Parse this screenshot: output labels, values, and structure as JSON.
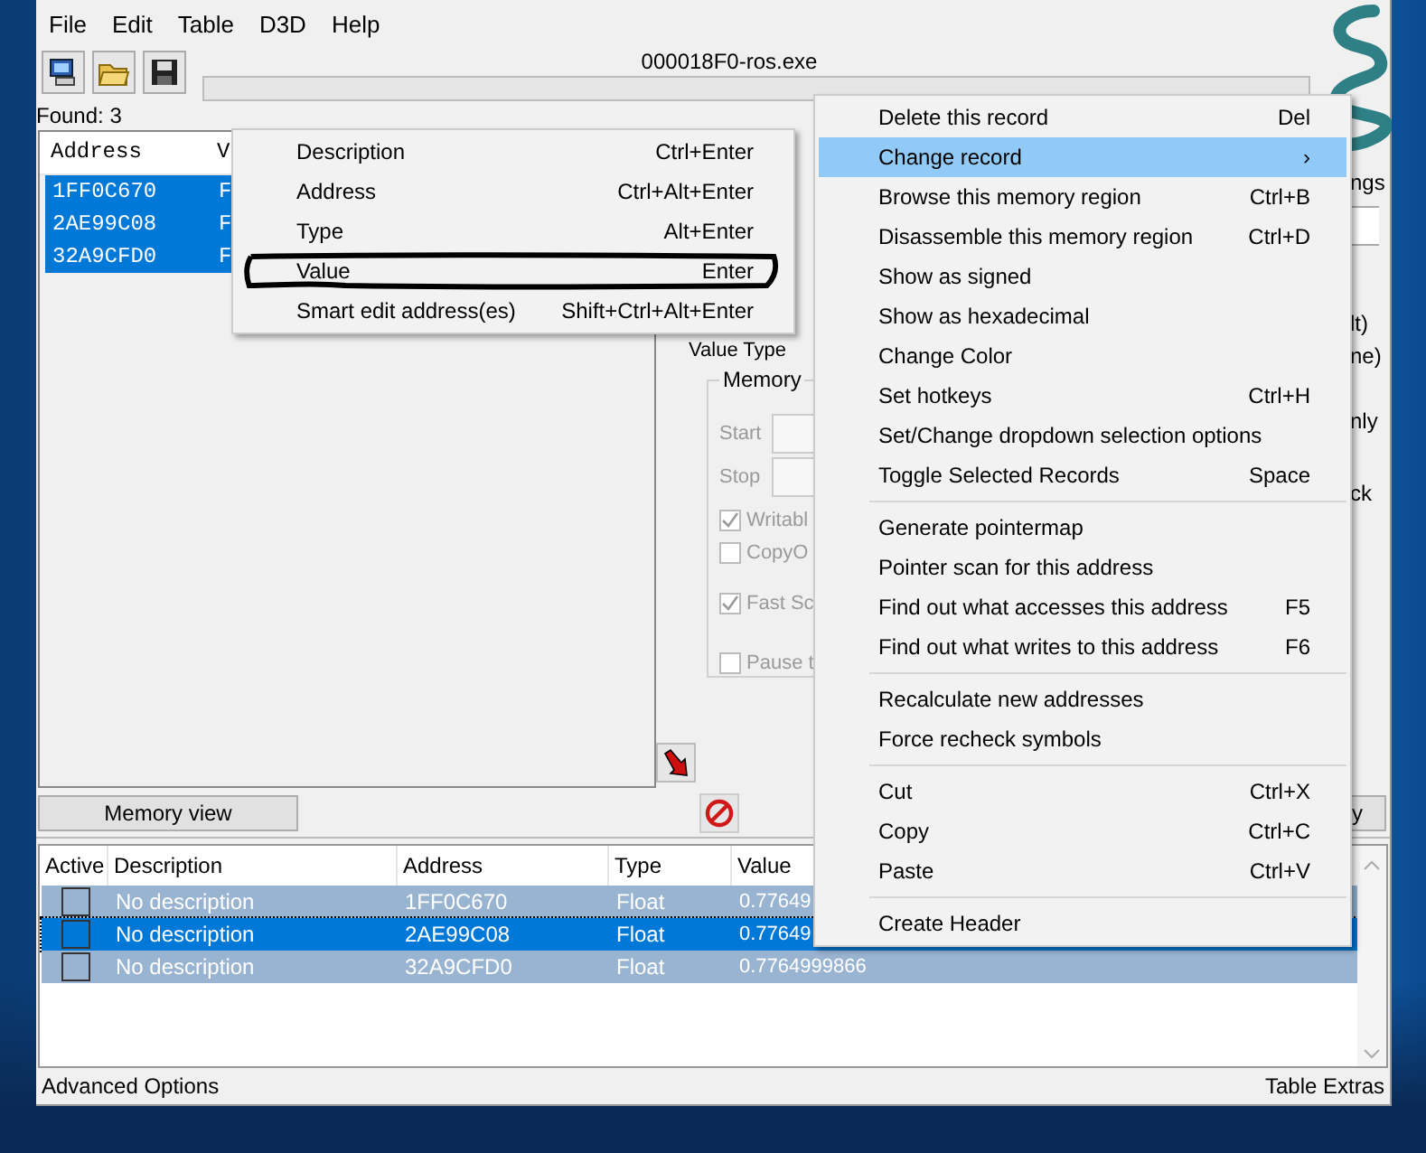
{
  "menu_bar": [
    "File",
    "Edit",
    "Table",
    "D3D",
    "Help"
  ],
  "process_title": "000018F0-ros.exe",
  "progress": {
    "level": 0
  },
  "found_label": "Found: 3",
  "found_list": {
    "columns": [
      "Address",
      "V"
    ],
    "rows": [
      {
        "address": "1FF0C670",
        "value": "F",
        "selected": true
      },
      {
        "address": "2AE99C08",
        "value": "F",
        "selected": true
      },
      {
        "address": "32A9CFD0",
        "value": "F",
        "selected": true
      }
    ]
  },
  "scan_panel": {
    "value_type_label": "Value Type",
    "memory_scan": {
      "title": "Memory",
      "disabled": true,
      "start_label": "Start",
      "stop_label": "Stop",
      "options": [
        {
          "label": "Writabl",
          "checked": true
        },
        {
          "label": "CopyO",
          "checked": false
        },
        {
          "label": "Fast Sc",
          "checked": true
        },
        {
          "label": "Pause t",
          "checked": false
        }
      ]
    },
    "right_edge_texts": [
      "ngs",
      "lt)",
      "ne)",
      "nly",
      "ck"
    ],
    "right_button": "y"
  },
  "memory_view_button": "Memory view",
  "address_table": {
    "columns": [
      "Active",
      "Description",
      "Address",
      "Type",
      "Value"
    ],
    "rows": [
      {
        "active": false,
        "description": "No description",
        "address": "1FF0C670",
        "type": "Float",
        "value": "0.77649",
        "selected": true,
        "focused": false
      },
      {
        "active": false,
        "description": "No description",
        "address": "2AE99C08",
        "type": "Float",
        "value": "0.77649",
        "selected": true,
        "focused": true
      },
      {
        "active": false,
        "description": "No description",
        "address": "32A9CFD0",
        "type": "Float",
        "value": "0.7764999866",
        "selected": true,
        "focused": false
      }
    ]
  },
  "status_bar": {
    "left": "Advanced Options",
    "right": "Table Extras"
  },
  "submenu": {
    "items": [
      {
        "kind": "item",
        "label": "Description",
        "shortcut": "Ctrl+Enter"
      },
      {
        "kind": "item",
        "label": "Address",
        "shortcut": "Ctrl+Alt+Enter"
      },
      {
        "kind": "item",
        "label": "Type",
        "shortcut": "Alt+Enter"
      },
      {
        "kind": "item",
        "label": "Value",
        "shortcut": "Enter",
        "circled": true
      },
      {
        "kind": "item",
        "label": "Smart edit address(es)",
        "shortcut": "Shift+Ctrl+Alt+Enter"
      }
    ]
  },
  "context_menu": {
    "items": [
      {
        "kind": "item",
        "label": "Delete this record",
        "shortcut": "Del",
        "selected": false
      },
      {
        "kind": "item",
        "label": "Change record",
        "arrow": "›",
        "selected": true
      },
      {
        "kind": "item",
        "label": "Browse this memory region",
        "shortcut": "Ctrl+B",
        "selected": false
      },
      {
        "kind": "item",
        "label": "Disassemble this memory region",
        "shortcut": "Ctrl+D",
        "selected": false
      },
      {
        "kind": "item",
        "label": "Show as signed",
        "selected": false
      },
      {
        "kind": "item",
        "label": "Show as hexadecimal",
        "selected": false
      },
      {
        "kind": "item",
        "label": "Change Color",
        "selected": false
      },
      {
        "kind": "item",
        "label": "Set hotkeys",
        "shortcut": "Ctrl+H",
        "selected": false
      },
      {
        "kind": "item",
        "label": "Set/Change dropdown selection options",
        "selected": false
      },
      {
        "kind": "item",
        "label": "Toggle Selected Records",
        "shortcut": "Space",
        "selected": false
      },
      {
        "kind": "separator"
      },
      {
        "kind": "item",
        "label": "Generate pointermap",
        "selected": false
      },
      {
        "kind": "item",
        "label": "Pointer scan for this address",
        "selected": false
      },
      {
        "kind": "item",
        "label": "Find out what accesses this address",
        "shortcut": "F5",
        "selected": false
      },
      {
        "kind": "item",
        "label": "Find out what writes to this address",
        "shortcut": "F6",
        "selected": false
      },
      {
        "kind": "separator"
      },
      {
        "kind": "item",
        "label": "Recalculate new addresses",
        "selected": false
      },
      {
        "kind": "item",
        "label": "Force recheck symbols",
        "selected": false
      },
      {
        "kind": "separator"
      },
      {
        "kind": "item",
        "label": "Cut",
        "shortcut": "Ctrl+X",
        "selected": false
      },
      {
        "kind": "item",
        "label": "Copy",
        "shortcut": "Ctrl+C",
        "selected": false
      },
      {
        "kind": "item",
        "label": "Paste",
        "shortcut": "Ctrl+V",
        "selected": false
      },
      {
        "kind": "separator"
      },
      {
        "kind": "item",
        "label": "Create Header",
        "selected": false
      }
    ]
  }
}
